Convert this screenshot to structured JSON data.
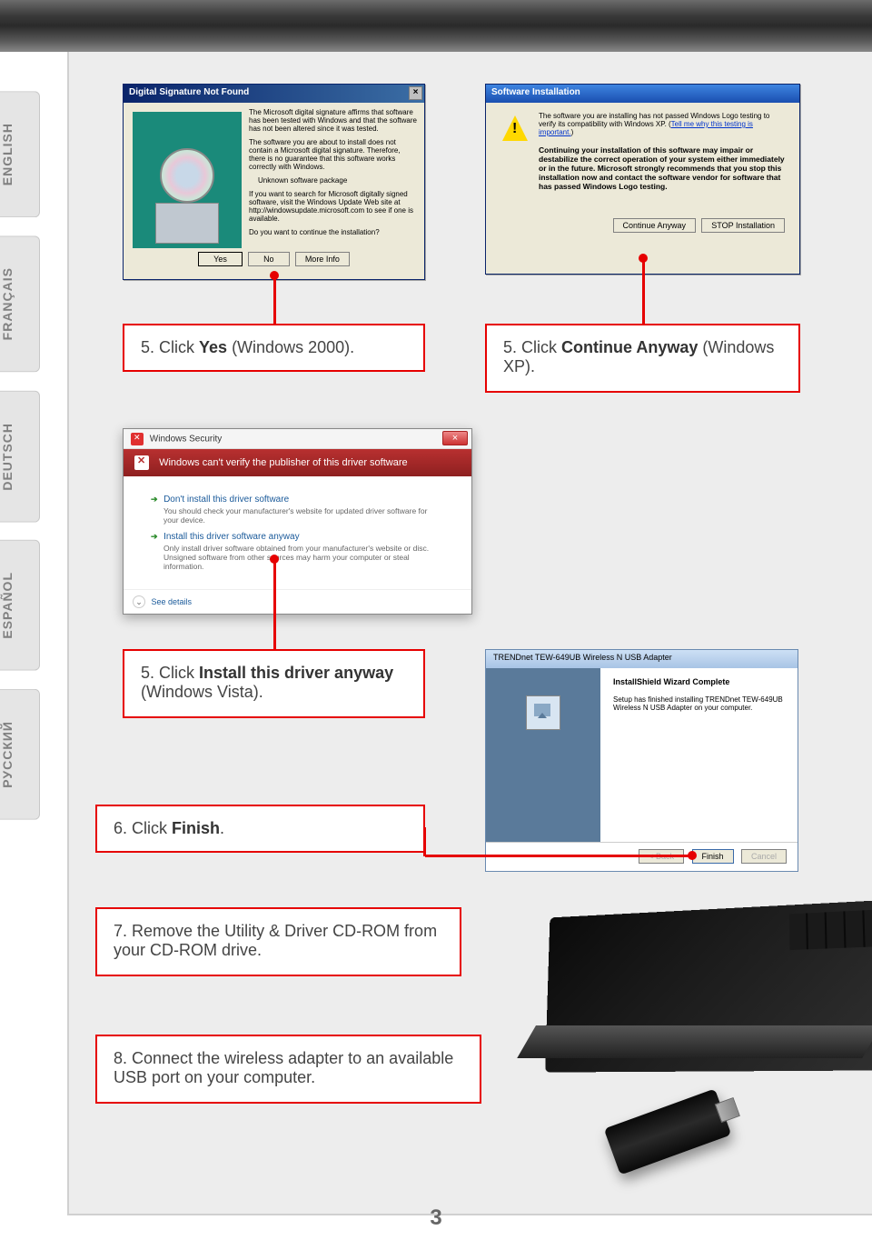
{
  "page_number": "3",
  "lang_tabs": [
    "ENGLISH",
    "FRANÇAIS",
    "DEUTSCH",
    "ESPAÑOL",
    "РУССКИЙ"
  ],
  "instructions": {
    "step5a_num": "5.",
    "step5a_pre": " Click ",
    "step5a_bold": "Yes",
    "step5a_post": " (Windows 2000).",
    "step5b_num": "5.",
    "step5b_pre": " Click ",
    "step5b_bold": "Continue Anyway",
    "step5b_post": " (Windows XP).",
    "step5c_num": "5.",
    "step5c_pre": " Click ",
    "step5c_bold": "Install this driver anyway",
    "step5c_post": " (Windows Vista).",
    "step6_num": "6.",
    "step6_pre": " Click ",
    "step6_bold": "Finish",
    "step6_post": ".",
    "step7_num": "7.",
    "step7_text": " Remove the Utility & Driver CD-ROM from your CD-ROM drive.",
    "step8_num": "8.",
    "step8_text": " Connect the wireless adapter to an available USB port on your computer."
  },
  "dialogs": {
    "digsig": {
      "title": "Digital Signature Not Found",
      "p1": "The Microsoft digital signature affirms that software has been tested with Windows and that the software has not been altered since it was tested.",
      "p2": "The software you are about to install does not contain a Microsoft digital signature. Therefore, there is no guarantee that this software works correctly with Windows.",
      "p3": "Unknown software package",
      "p4": "If you want to search for Microsoft digitally signed software, visit the Windows Update Web site at http://windowsupdate.microsoft.com to see if one is available.",
      "p5": "Do you want to continue the installation?",
      "btn_yes": "Yes",
      "btn_no": "No",
      "btn_more": "More Info"
    },
    "xpinst": {
      "title": "Software Installation",
      "p1a": "The software you are installing has not passed Windows Logo testing to verify its compatibility with Windows XP. (",
      "p1link": "Tell me why this testing is important.",
      "p1b": ")",
      "p2": "Continuing your installation of this software may impair or destabilize the correct operation of your system either immediately or in the future. Microsoft strongly recommends that you stop this installation now and contact the software vendor for software that has passed Windows Logo testing.",
      "btn_continue": "Continue Anyway",
      "btn_stop": "STOP Installation"
    },
    "vista": {
      "title": "Windows Security",
      "redbar": "Windows can't verify the publisher of this driver software",
      "opt1": "Don't install this driver software",
      "opt1_desc": "You should check your manufacturer's website for updated driver software for your device.",
      "opt2": "Install this driver software anyway",
      "opt2_desc": "Only install driver software obtained from your manufacturer's website or disc. Unsigned software from other sources may harm your computer or steal information.",
      "details": "See details"
    },
    "ishield": {
      "title": "TRENDnet TEW-649UB Wireless N USB Adapter",
      "heading": "InstallShield Wizard Complete",
      "body": "Setup has finished installing TRENDnet TEW-649UB Wireless N USB Adapter on your computer.",
      "btn_back": "< Back",
      "btn_finish": "Finish",
      "btn_cancel": "Cancel"
    }
  }
}
